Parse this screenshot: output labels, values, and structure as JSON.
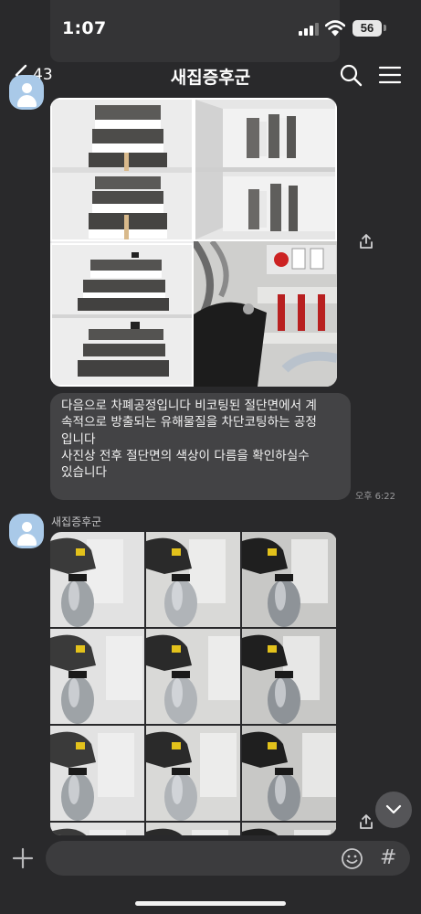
{
  "status_bar": {
    "time": "1:07",
    "battery": "56"
  },
  "header": {
    "back_count": "43",
    "title": "새집증후군"
  },
  "icons": {
    "back": "chevron-left-icon",
    "search": "search-icon",
    "menu": "hamburger-menu-icon",
    "share": "share-icon",
    "scroll_down": "chevron-down-icon",
    "add": "plus-icon",
    "emoji": "emoji-icon",
    "hashtag": "hash-icon"
  },
  "messages": [
    {
      "type": "photos",
      "photo_count": 4
    },
    {
      "type": "text",
      "lines": [
        "다음으로 차폐공정입니다 비코팅된 절단면에서 계",
        "속적으로 방출되는 유해물질을 차단코팅하는 공정",
        "입니다",
        "사진상 전후 절단면의 색상이 다름을 확인하실수",
        "있습니다"
      ],
      "time": "오후 6:22"
    },
    {
      "type": "photos",
      "sender": "새집증후군",
      "photo_count": 12
    }
  ],
  "input": {
    "placeholder": "",
    "hash_label": "#"
  },
  "colors": {
    "background": "#29292b",
    "bubble": "#434345",
    "avatar": "#a9c9e8"
  }
}
